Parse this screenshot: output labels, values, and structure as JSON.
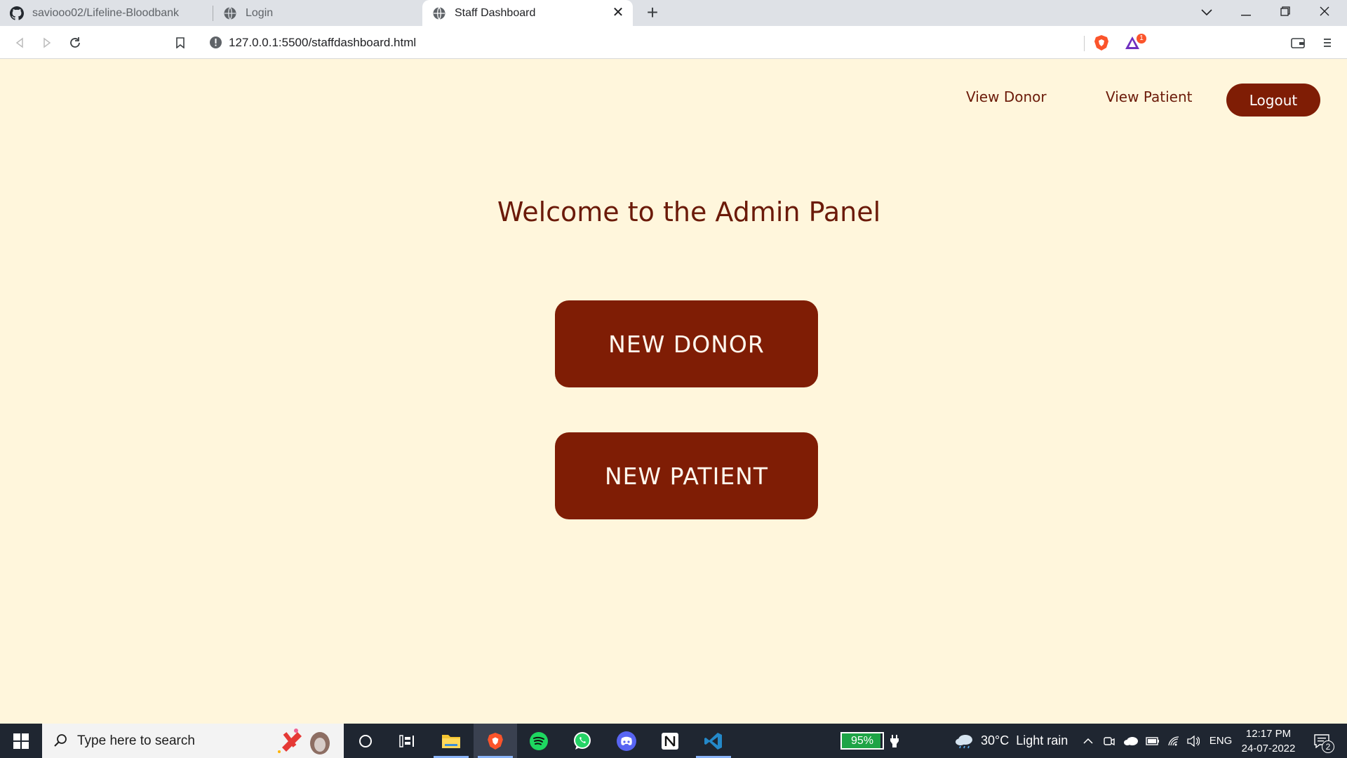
{
  "browser": {
    "tabs": [
      {
        "title": "saviooo02/Lifeline-Bloodbank",
        "icon": "github-icon",
        "active": false
      },
      {
        "title": "Login",
        "icon": "globe-icon",
        "active": false
      },
      {
        "title": "Staff Dashboard",
        "icon": "globe-icon",
        "active": true
      }
    ],
    "url": "127.0.0.1:5500/staffdashboard.html",
    "brave_badge": "1"
  },
  "page": {
    "nav": {
      "view_donor": "View Donor",
      "view_patient": "View Patient",
      "logout": "Logout"
    },
    "heading": "Welcome to the Admin Panel",
    "buttons": {
      "new_donor": "NEW DONOR",
      "new_patient": "NEW PATIENT"
    },
    "colors": {
      "background": "#fff6dc",
      "accent": "#7f1d05",
      "text": "#6b1a09"
    }
  },
  "taskbar": {
    "search_placeholder": "Type here to search",
    "battery": "95%",
    "battery_level": 0.95,
    "weather": "30°C  Light rain",
    "language": "ENG",
    "time": "12:17 PM",
    "date": "24-07-2022",
    "notifications": "2"
  }
}
